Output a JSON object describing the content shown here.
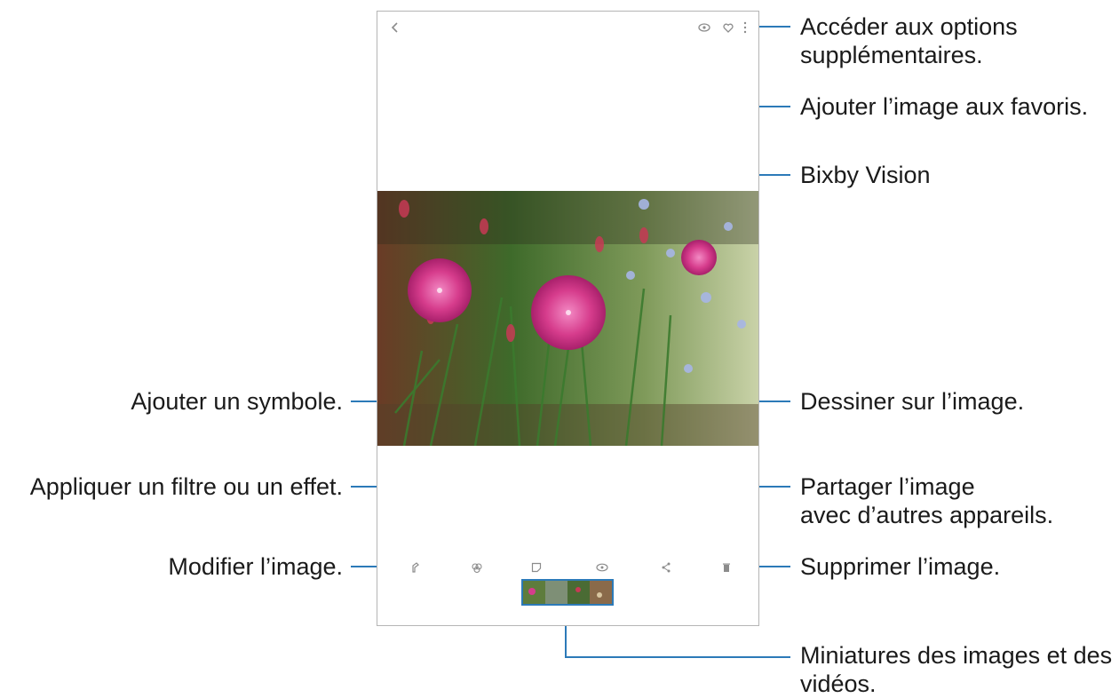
{
  "annotations": {
    "more_options": "Accéder aux options\nsupplémentaires.",
    "favorite": "Ajouter l’image aux favoris.",
    "bixby_vision": "Bixby Vision",
    "add_sticker": "Ajouter un symbole.",
    "draw": "Dessiner sur l’image.",
    "filter": "Appliquer un filtre ou un effet.",
    "share": "Partager l’image\navec d’autres appareils.",
    "edit": "Modifier l’image.",
    "delete": "Supprimer l’image.",
    "thumbnails": "Miniatures des images et des\nvidéos."
  },
  "colors": {
    "callout_line": "#2c7ab8",
    "flower_pink": "#d63c8c",
    "foliage": "#4f7a3a"
  },
  "icons": {
    "top_bar": [
      "back-arrow-icon",
      "bixby-vision-icon",
      "favorite-heart-icon",
      "more-options-icon"
    ],
    "bottom_bar": [
      "edit-pencil-icon",
      "filter-icon",
      "sticker-icon",
      "draw-icon",
      "share-icon",
      "delete-trash-icon"
    ]
  }
}
